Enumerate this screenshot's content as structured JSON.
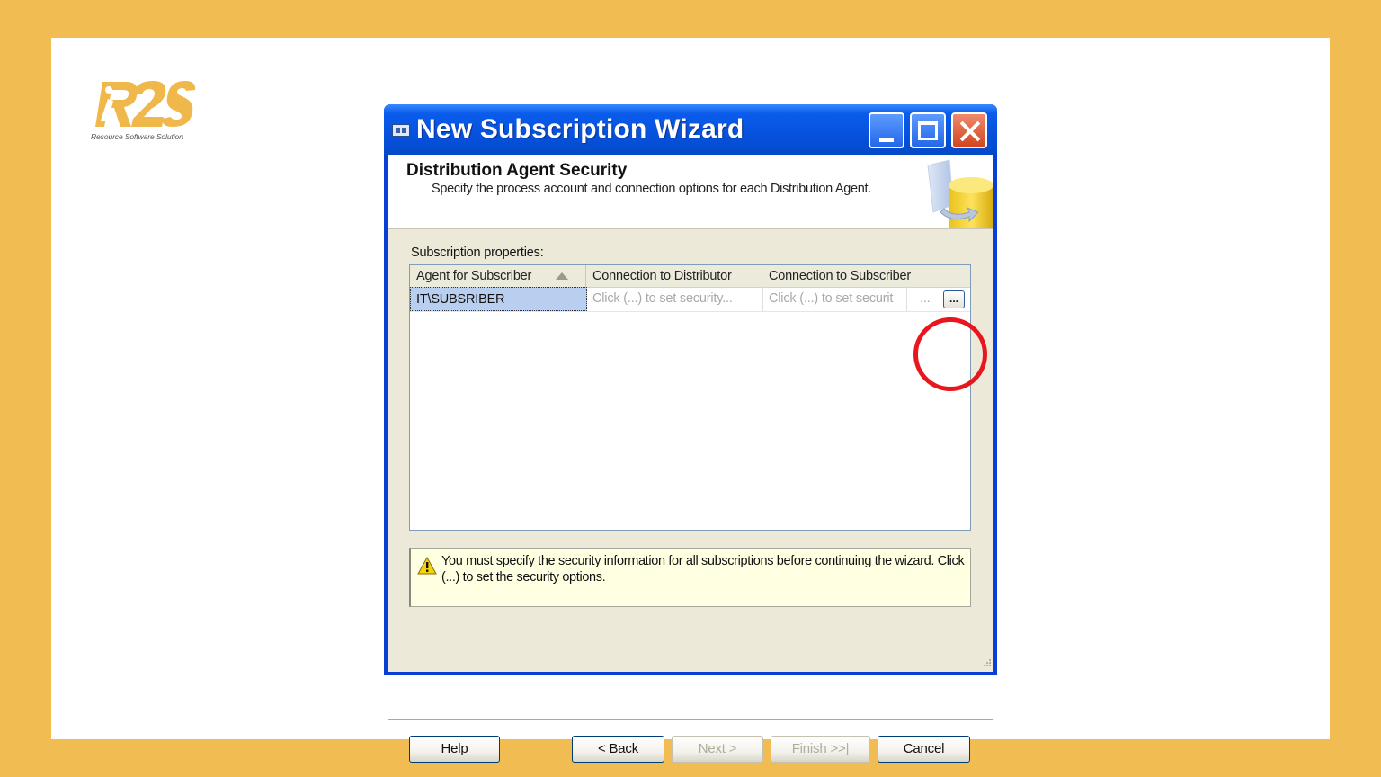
{
  "logo": {
    "mark": "R2S",
    "tagline": "Resource Software Solution"
  },
  "window": {
    "title": "New Subscription Wizard",
    "controls": {
      "minimize": "minimize",
      "maximize": "maximize",
      "close": "close"
    }
  },
  "page": {
    "heading": "Distribution Agent Security",
    "description": "Specify the process account and connection options for each Distribution Agent."
  },
  "subscription_properties": {
    "label": "Subscription properties:",
    "columns": [
      "Agent for Subscriber",
      "Connection to Distributor",
      "Connection to Subscriber"
    ],
    "rows": [
      {
        "agent": "IT\\SUBSRIBER",
        "distributor": "Click (...) to set security...",
        "subscriber": "Click (...) to set securit",
        "subscriber_more": "...",
        "button": "..."
      }
    ]
  },
  "warning": {
    "text": "You must specify the security information for all subscriptions before continuing the wizard. Click (...) to set the security options."
  },
  "buttons": {
    "help": "Help",
    "back": "< Back",
    "next": "Next >",
    "finish": "Finish >>|",
    "cancel": "Cancel"
  },
  "colors": {
    "page_background": "#F1BD53",
    "titlebar": "#0753E0",
    "highlight_ring": "#E8161E",
    "selected_row": "#B9CFF0"
  }
}
